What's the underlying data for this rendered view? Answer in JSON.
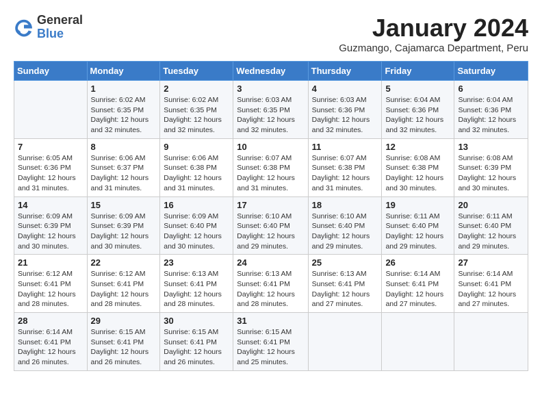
{
  "logo": {
    "general": "General",
    "blue": "Blue"
  },
  "header": {
    "title": "January 2024",
    "location": "Guzmango, Cajamarca Department, Peru"
  },
  "weekdays": [
    "Sunday",
    "Monday",
    "Tuesday",
    "Wednesday",
    "Thursday",
    "Friday",
    "Saturday"
  ],
  "weeks": [
    [
      {
        "day": "",
        "info": ""
      },
      {
        "day": "1",
        "info": "Sunrise: 6:02 AM\nSunset: 6:35 PM\nDaylight: 12 hours\nand 32 minutes."
      },
      {
        "day": "2",
        "info": "Sunrise: 6:02 AM\nSunset: 6:35 PM\nDaylight: 12 hours\nand 32 minutes."
      },
      {
        "day": "3",
        "info": "Sunrise: 6:03 AM\nSunset: 6:35 PM\nDaylight: 12 hours\nand 32 minutes."
      },
      {
        "day": "4",
        "info": "Sunrise: 6:03 AM\nSunset: 6:36 PM\nDaylight: 12 hours\nand 32 minutes."
      },
      {
        "day": "5",
        "info": "Sunrise: 6:04 AM\nSunset: 6:36 PM\nDaylight: 12 hours\nand 32 minutes."
      },
      {
        "day": "6",
        "info": "Sunrise: 6:04 AM\nSunset: 6:36 PM\nDaylight: 12 hours\nand 32 minutes."
      }
    ],
    [
      {
        "day": "7",
        "info": "Sunrise: 6:05 AM\nSunset: 6:36 PM\nDaylight: 12 hours\nand 31 minutes."
      },
      {
        "day": "8",
        "info": "Sunrise: 6:06 AM\nSunset: 6:37 PM\nDaylight: 12 hours\nand 31 minutes."
      },
      {
        "day": "9",
        "info": "Sunrise: 6:06 AM\nSunset: 6:38 PM\nDaylight: 12 hours\nand 31 minutes."
      },
      {
        "day": "10",
        "info": "Sunrise: 6:07 AM\nSunset: 6:38 PM\nDaylight: 12 hours\nand 31 minutes."
      },
      {
        "day": "11",
        "info": "Sunrise: 6:07 AM\nSunset: 6:38 PM\nDaylight: 12 hours\nand 31 minutes."
      },
      {
        "day": "12",
        "info": "Sunrise: 6:08 AM\nSunset: 6:38 PM\nDaylight: 12 hours\nand 30 minutes."
      },
      {
        "day": "13",
        "info": "Sunrise: 6:08 AM\nSunset: 6:39 PM\nDaylight: 12 hours\nand 30 minutes."
      }
    ],
    [
      {
        "day": "14",
        "info": "Sunrise: 6:09 AM\nSunset: 6:39 PM\nDaylight: 12 hours\nand 30 minutes."
      },
      {
        "day": "15",
        "info": "Sunrise: 6:09 AM\nSunset: 6:39 PM\nDaylight: 12 hours\nand 30 minutes."
      },
      {
        "day": "16",
        "info": "Sunrise: 6:09 AM\nSunset: 6:40 PM\nDaylight: 12 hours\nand 30 minutes."
      },
      {
        "day": "17",
        "info": "Sunrise: 6:10 AM\nSunset: 6:40 PM\nDaylight: 12 hours\nand 29 minutes."
      },
      {
        "day": "18",
        "info": "Sunrise: 6:10 AM\nSunset: 6:40 PM\nDaylight: 12 hours\nand 29 minutes."
      },
      {
        "day": "19",
        "info": "Sunrise: 6:11 AM\nSunset: 6:40 PM\nDaylight: 12 hours\nand 29 minutes."
      },
      {
        "day": "20",
        "info": "Sunrise: 6:11 AM\nSunset: 6:40 PM\nDaylight: 12 hours\nand 29 minutes."
      }
    ],
    [
      {
        "day": "21",
        "info": "Sunrise: 6:12 AM\nSunset: 6:41 PM\nDaylight: 12 hours\nand 28 minutes."
      },
      {
        "day": "22",
        "info": "Sunrise: 6:12 AM\nSunset: 6:41 PM\nDaylight: 12 hours\nand 28 minutes."
      },
      {
        "day": "23",
        "info": "Sunrise: 6:13 AM\nSunset: 6:41 PM\nDaylight: 12 hours\nand 28 minutes."
      },
      {
        "day": "24",
        "info": "Sunrise: 6:13 AM\nSunset: 6:41 PM\nDaylight: 12 hours\nand 28 minutes."
      },
      {
        "day": "25",
        "info": "Sunrise: 6:13 AM\nSunset: 6:41 PM\nDaylight: 12 hours\nand 27 minutes."
      },
      {
        "day": "26",
        "info": "Sunrise: 6:14 AM\nSunset: 6:41 PM\nDaylight: 12 hours\nand 27 minutes."
      },
      {
        "day": "27",
        "info": "Sunrise: 6:14 AM\nSunset: 6:41 PM\nDaylight: 12 hours\nand 27 minutes."
      }
    ],
    [
      {
        "day": "28",
        "info": "Sunrise: 6:14 AM\nSunset: 6:41 PM\nDaylight: 12 hours\nand 26 minutes."
      },
      {
        "day": "29",
        "info": "Sunrise: 6:15 AM\nSunset: 6:41 PM\nDaylight: 12 hours\nand 26 minutes."
      },
      {
        "day": "30",
        "info": "Sunrise: 6:15 AM\nSunset: 6:41 PM\nDaylight: 12 hours\nand 26 minutes."
      },
      {
        "day": "31",
        "info": "Sunrise: 6:15 AM\nSunset: 6:41 PM\nDaylight: 12 hours\nand 25 minutes."
      },
      {
        "day": "",
        "info": ""
      },
      {
        "day": "",
        "info": ""
      },
      {
        "day": "",
        "info": ""
      }
    ]
  ]
}
